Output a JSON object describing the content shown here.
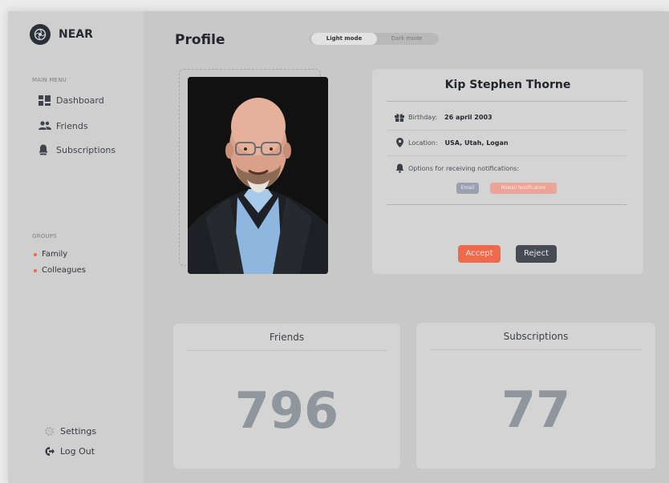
{
  "brand": {
    "name": "NEAR"
  },
  "sidebar": {
    "main_menu_label": "MAIN MENU",
    "items": [
      {
        "label": "Dashboard",
        "icon": "dashboard-icon"
      },
      {
        "label": "Friends",
        "icon": "friends-icon"
      },
      {
        "label": "Subscriptions",
        "icon": "subscriptions-icon"
      }
    ],
    "groups_label": "GROUPS",
    "groups": [
      {
        "label": "Family"
      },
      {
        "label": "Colleagues"
      }
    ],
    "bottom": [
      {
        "label": "Settings",
        "icon": "settings-icon"
      },
      {
        "label": "Log Out",
        "icon": "logout-icon"
      }
    ]
  },
  "header": {
    "title": "Profile",
    "mode_toggle": {
      "light": "Light mode",
      "dark": "Dark mode",
      "selected": "Light mode"
    }
  },
  "profile": {
    "name": "Kip Stephen Thorne",
    "birthday_label": "Birthday:",
    "birthday_value": "26 april 2003",
    "location_label": "Location:",
    "location_value": "USA, Utah, Logan",
    "notifications_label": "Options for receiving notifications:",
    "notification_options": [
      "Email",
      "Mobail Notification"
    ],
    "accept_label": "Accept",
    "reject_label": "Reject"
  },
  "stats": {
    "friends": {
      "label": "Friends",
      "value": "796"
    },
    "subscriptions": {
      "label": "Subscriptions",
      "value": "77"
    }
  },
  "colors": {
    "accent": "#ef6a4c",
    "dark_button": "#454a53",
    "background": "#c8c8c8",
    "card": "#d4d4d4"
  }
}
